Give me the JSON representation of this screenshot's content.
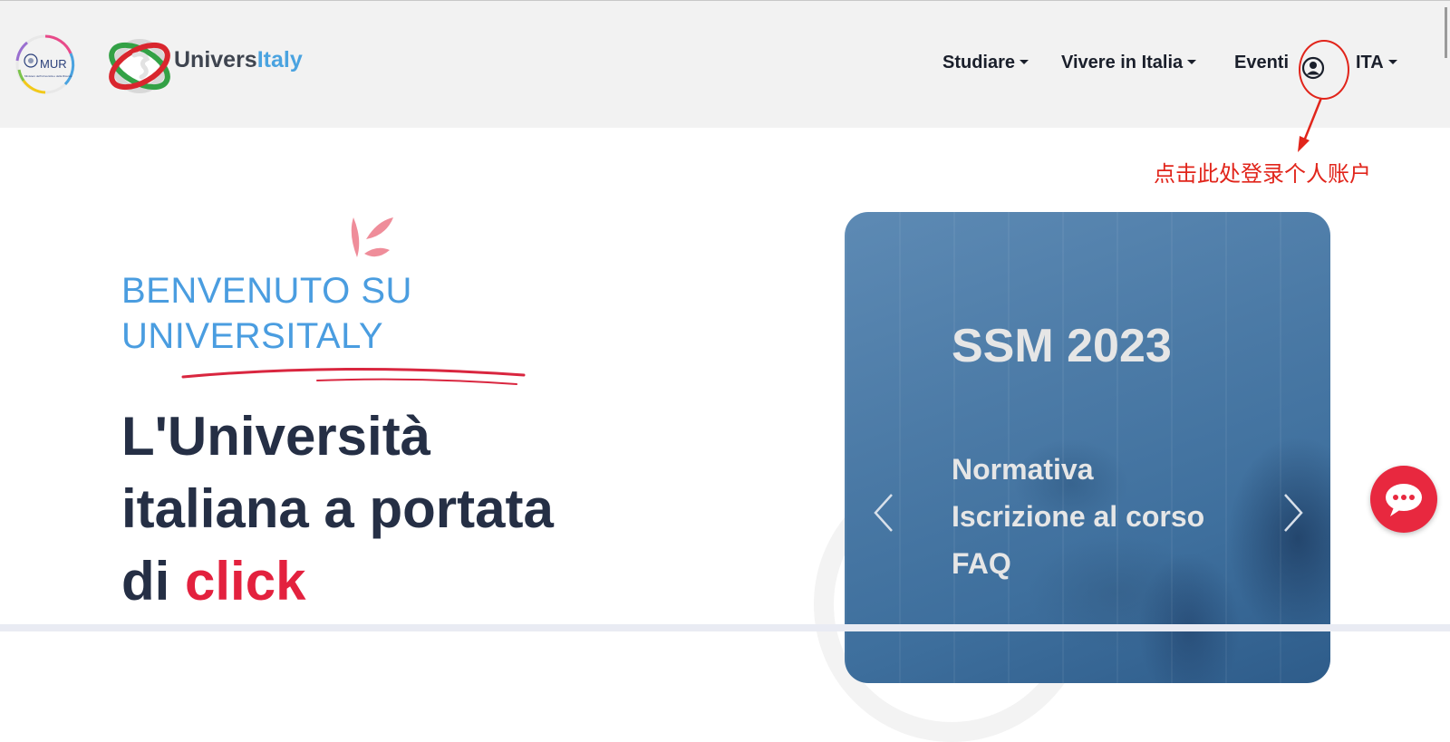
{
  "header": {
    "mur_logo": {
      "text": "MUR",
      "subtitle": "Ministero dell'Università e della Ricerca"
    },
    "brand": {
      "part1": "Univers",
      "part2": "Italy",
      "accent": "#4aa3e0"
    },
    "nav": [
      {
        "label": "Studiare",
        "dropdown": true
      },
      {
        "label": "Vivere in Italia",
        "dropdown": true
      },
      {
        "label": "Eventi",
        "dropdown": false
      }
    ],
    "user_icon": "user-circle-icon",
    "language": "ITA"
  },
  "annotation": {
    "text": "点击此处登录个人账户",
    "color": "#e1251b"
  },
  "hero": {
    "welcome_line1": "BENVENUTO SU",
    "welcome_line2": "UNIVERSITALY",
    "headline_line1": "L'Università",
    "headline_line2": "italiana a portata",
    "headline_line3_prefix": "di ",
    "headline_line3_accent": "click",
    "accent_color": "#e3213e",
    "welcome_color": "#4a9de0"
  },
  "carousel": {
    "title": "SSM 2023",
    "links": [
      "Normativa",
      "Iscrizione al corso",
      "FAQ"
    ],
    "prev_icon": "chevron-left-icon",
    "next_icon": "chevron-right-icon"
  },
  "chat": {
    "icon": "chat-bubble-icon",
    "color": "#e8283f"
  }
}
